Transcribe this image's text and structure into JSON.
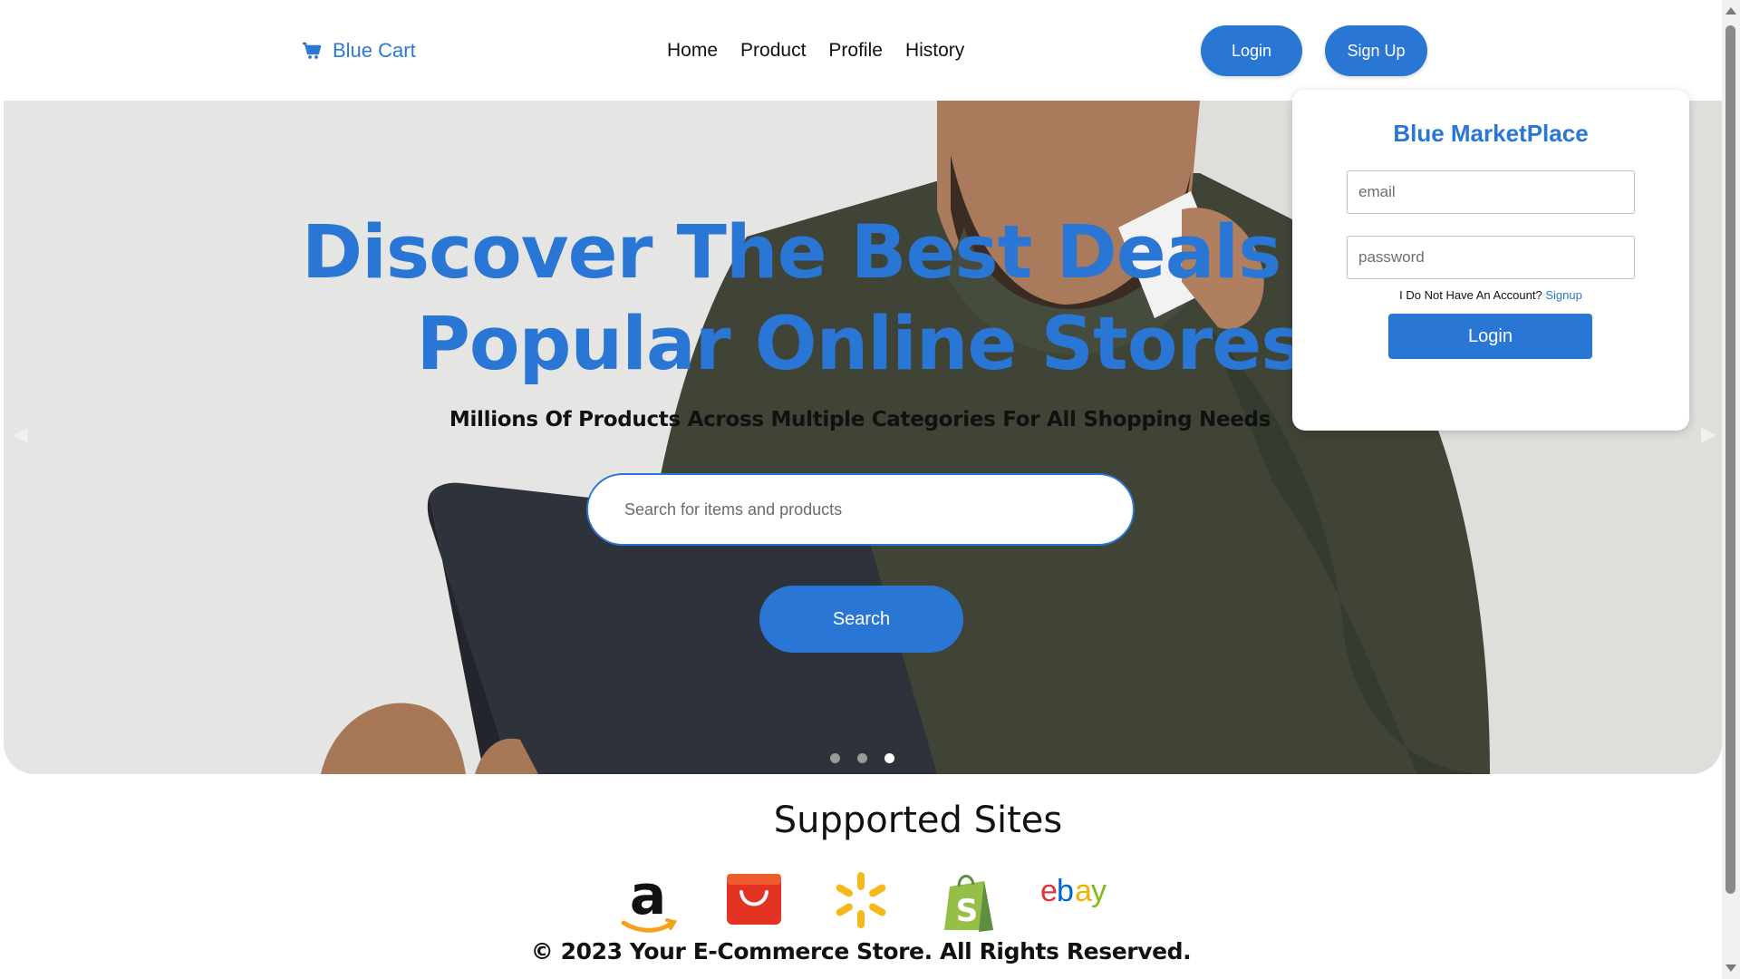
{
  "navbar": {
    "brand": "Blue Cart",
    "links": [
      "Home",
      "Product",
      "Profile",
      "History"
    ],
    "login_label": "Login",
    "signup_label": "Sign Up"
  },
  "hero": {
    "headline_line1_dark": "Discover The",
    "headline_line1_blue": "Best Deals On",
    "headline_line2_dark": "Popular",
    "headline_line2_blue": "Online Stores",
    "subheadline": "Millions Of Products Across Multiple Categories For All Shopping Needs",
    "search_placeholder": "Search for items and products",
    "search_button": "Search",
    "slide_count": 3,
    "active_slide": 3
  },
  "login_card": {
    "title": "Blue MarketPlace",
    "email_placeholder": "email",
    "password_placeholder": "password",
    "signup_prompt": "I Do Not Have An Account?",
    "signup_link": "Signup",
    "login_button": "Login"
  },
  "supported": {
    "title": "Supported Sites",
    "sites": [
      "amazon-logo",
      "aliexpress-logo",
      "walmart-logo",
      "shopify-logo",
      "ebay-logo"
    ]
  },
  "footer": {
    "copyright": "© 2023 Your E-Commerce Store. All Rights Reserved."
  },
  "colors": {
    "brand_blue": "#2a76d4",
    "dark_text": "#111111"
  }
}
